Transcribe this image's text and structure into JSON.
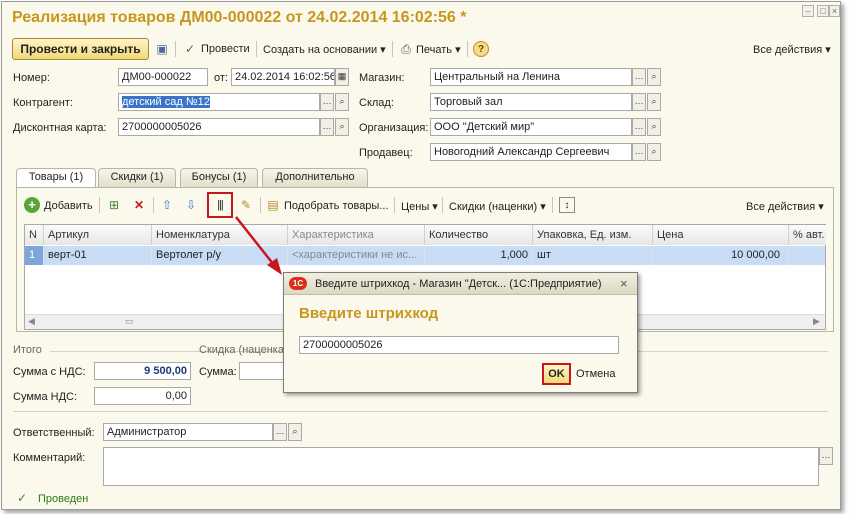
{
  "window": {
    "title": "Реализация товаров ДМ00-000022 от 24.02.2014 16:02:56 *"
  },
  "toolbar": {
    "post_close": "Провести и закрыть",
    "post": "Провести",
    "create_based": "Создать на основании",
    "print": "Печать",
    "all_actions": "Все действия",
    "help": "?"
  },
  "fields": {
    "number_label": "Номер:",
    "number": "ДМ00-000022",
    "date_label": "от:",
    "date": "24.02.2014 16:02:56",
    "store_label": "Магазин:",
    "store": "Центральный на Ленина",
    "counterparty_label": "Контрагент:",
    "counterparty": "детский сад №12",
    "warehouse_label": "Склад:",
    "warehouse": "Торговый зал",
    "card_label": "Дисконтная карта:",
    "card": "2700000005026",
    "org_label": "Организация:",
    "org": "ООО \"Детский мир\"",
    "seller_label": "Продавец:",
    "seller": "Новогодний Александр Сергеевич"
  },
  "tabs": [
    "Товары (1)",
    "Скидки (1)",
    "Бонусы (1)",
    "Дополнительно"
  ],
  "goods_toolbar": {
    "add": "Добавить",
    "pick": "Подобрать товары...",
    "prices": "Цены",
    "discounts": "Скидки (наценки)",
    "all_actions": "Все действия"
  },
  "table": {
    "columns": [
      "N",
      "Артикул",
      "Номенклатура",
      "Характеристика",
      "Количество",
      "Упаковка, Ед. изм.",
      "Цена",
      "% авт."
    ],
    "rows": [
      [
        "1",
        "верт-01",
        "Вертолет р/у",
        "<характеристики не ис...",
        "1,000",
        "шт",
        "10 000,00",
        ""
      ]
    ]
  },
  "totals": {
    "header": "Итого",
    "sum_vat_label": "Сумма с НДС:",
    "sum_vat": "9 500,00",
    "vat_label": "Сумма НДС:",
    "vat": "0,00",
    "discount_header": "Скидка (наценка",
    "discount_sum_label": "Сумма:"
  },
  "footer": {
    "responsible_label": "Ответственный:",
    "responsible": "Администратор",
    "comment_label": "Комментарий:",
    "status": "Проведен"
  },
  "dialog": {
    "title": "Введите штрихкод - Магазин \"Детск...   (1С:Предприятие)",
    "heading": "Введите штрихкод",
    "value": "2700000005026",
    "ok": "OK",
    "cancel": "Отмена"
  },
  "colors": {
    "accent": "#c7961f",
    "highlight": "#c8161d",
    "selection": "#c8ddf5"
  }
}
